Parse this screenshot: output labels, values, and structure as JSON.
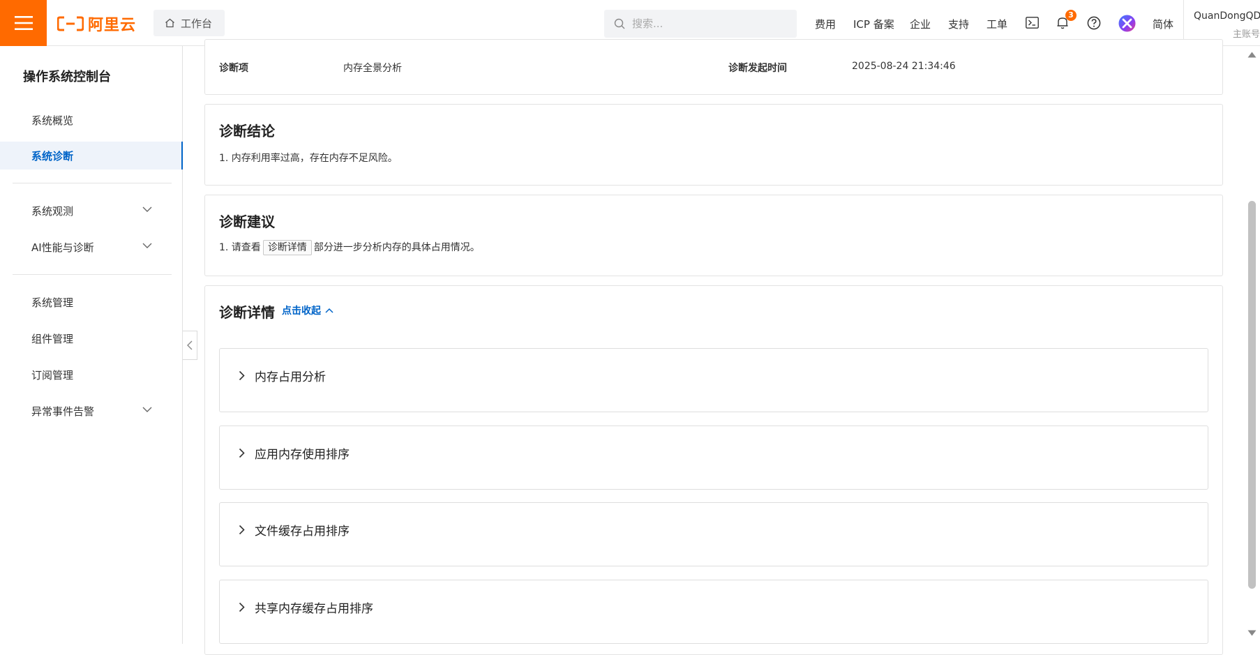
{
  "header": {
    "brand": "阿里云",
    "workbench_label": "工作台",
    "search_placeholder": "搜索...",
    "nav": [
      "费用",
      "ICP 备案",
      "企业",
      "支持",
      "工单"
    ],
    "notification_count": "3",
    "language": "简体",
    "account_name": "QuanDongQD",
    "account_role": "主账号",
    "accent_color": "#ff6a00"
  },
  "sidebar": {
    "title": "操作系统控制台",
    "items": [
      {
        "label": "系统概览"
      },
      {
        "label": "系统诊断"
      },
      {
        "label": "系统观测"
      },
      {
        "label": "AI性能与诊断"
      },
      {
        "label": "系统管理"
      },
      {
        "label": "组件管理"
      },
      {
        "label": "订阅管理"
      },
      {
        "label": "异常事件告警"
      }
    ],
    "active_color": "#0064c8"
  },
  "meta": {
    "item_label": "诊断项",
    "item_value": "内存全景分析",
    "time_label": "诊断发起时间",
    "time_value": "2025-08-24 21:34:46"
  },
  "conclusion": {
    "title": "诊断结论",
    "text": "1. 内存利用率过高，存在内存不足风险。"
  },
  "suggestion": {
    "title": "诊断建议",
    "prefix": "1. 请查看",
    "link": "诊断详情",
    "suffix": "部分进一步分析内存的具体占用情况。"
  },
  "details": {
    "title": "诊断详情",
    "collapse_label": "点击收起",
    "sections": [
      {
        "label": "内存占用分析"
      },
      {
        "label": "应用内存使用排序"
      },
      {
        "label": "文件缓存占用排序"
      },
      {
        "label": "共享内存缓存占用排序"
      }
    ]
  }
}
